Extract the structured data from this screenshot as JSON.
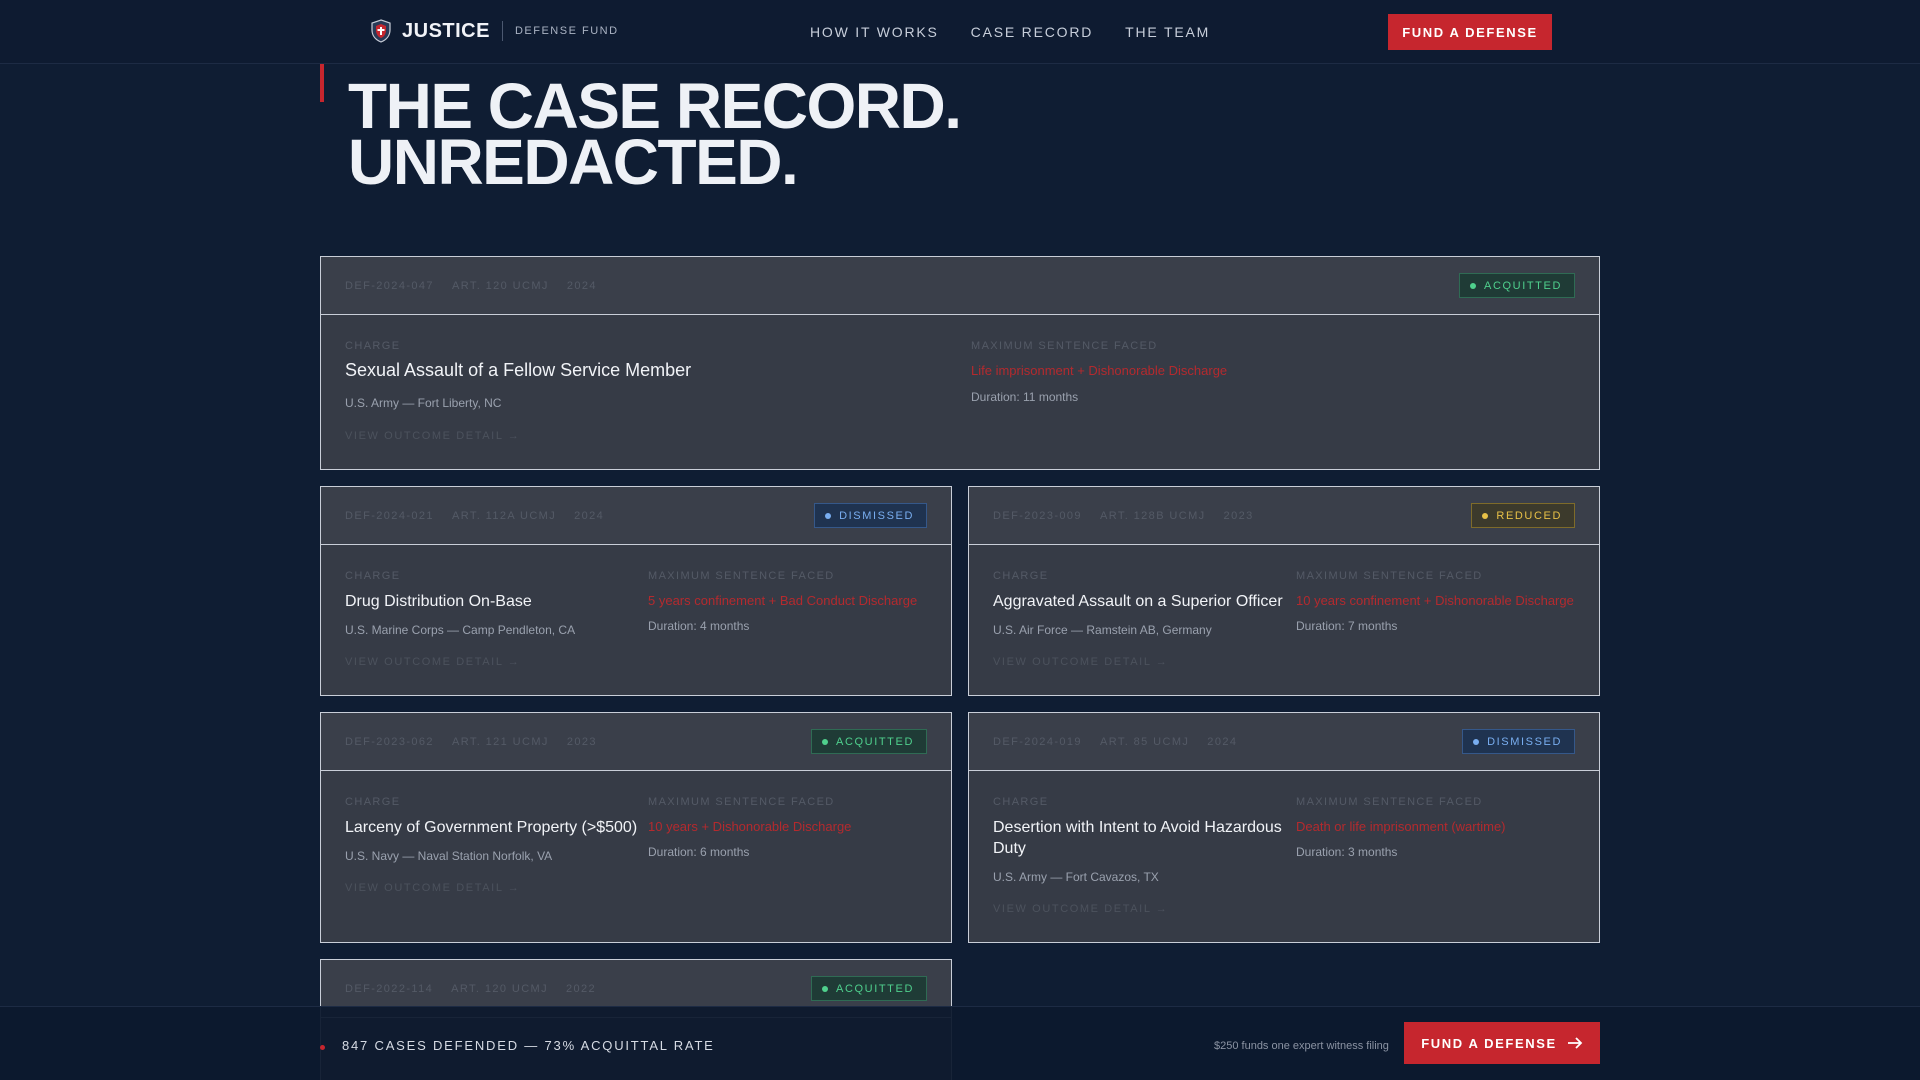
{
  "nav": {
    "brand": "JUSTICE",
    "brand_sub": "DEFENSE FUND",
    "links": [
      "HOW IT WORKS",
      "CASE RECORD",
      "THE TEAM"
    ],
    "cta": "FUND A DEFENSE"
  },
  "hero": {
    "line1": "THE CASE RECORD.",
    "line2": "UNREDACTED."
  },
  "labels": {
    "charge": "CHARGE",
    "max_sentence": "MAXIMUM SENTENCE FACED",
    "detail": "VIEW OUTCOME DETAIL →"
  },
  "cases": [
    {
      "id": "DEF-2024-047",
      "article": "ART. 120 UCMJ",
      "year": "2024",
      "status": "ACQUITTED",
      "charge": "Sexual Assault of a Fellow Service Member",
      "unit": "U.S. Army — Fort Liberty, NC",
      "sentence": "Life imprisonment + Dishonorable Discharge",
      "duration": "Duration: 11 months"
    },
    {
      "id": "DEF-2024-021",
      "article": "ART. 112A UCMJ",
      "year": "2024",
      "status": "DISMISSED",
      "charge": "Drug Distribution On-Base",
      "unit": "U.S. Marine Corps — Camp Pendleton, CA",
      "sentence": "5 years confinement + Bad Conduct Discharge",
      "duration": "Duration: 4 months"
    },
    {
      "id": "DEF-2023-009",
      "article": "ART. 128B UCMJ",
      "year": "2023",
      "status": "REDUCED",
      "charge": "Aggravated Assault on a Superior Officer",
      "unit": "U.S. Air Force — Ramstein AB, Germany",
      "sentence": "10 years confinement + Dishonorable Discharge",
      "duration": "Duration: 7 months"
    },
    {
      "id": "DEF-2023-062",
      "article": "ART. 121 UCMJ",
      "year": "2023",
      "status": "ACQUITTED",
      "charge": "Larceny of Government Property (>$500)",
      "unit": "U.S. Navy — Naval Station Norfolk, VA",
      "sentence": "10 years + Dishonorable Discharge",
      "duration": "Duration: 6 months"
    },
    {
      "id": "DEF-2024-019",
      "article": "ART. 85 UCMJ",
      "year": "2024",
      "status": "DISMISSED",
      "charge": "Desertion with Intent to Avoid Hazardous Duty",
      "unit": "U.S. Army — Fort Cavazos, TX",
      "sentence": "Death or life imprisonment (wartime)",
      "duration": "Duration: 3 months"
    },
    {
      "id": "DEF-2022-114",
      "article": "ART. 120 UCMJ",
      "year": "2022",
      "status": "ACQUITTED"
    }
  ],
  "bottom": {
    "stat": "847 CASES DEFENDED — 73% ACQUITTAL RATE",
    "note": "$250 funds one expert witness filing",
    "cta": "FUND A DEFENSE"
  },
  "colors": {
    "background": "#0f1d33",
    "accent": "#c6262e",
    "acquitted": "#4fd08d",
    "dismissed": "#79aef0",
    "reduced": "#e8c147"
  }
}
